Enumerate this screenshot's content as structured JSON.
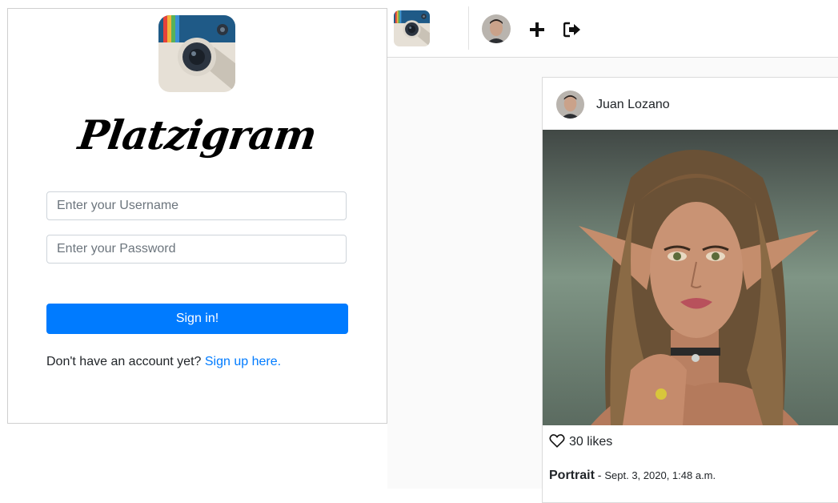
{
  "login": {
    "brand_title": "Platzigram",
    "username_placeholder": "Enter your Username",
    "password_placeholder": "Enter your Password",
    "signin_label": "Sign in!",
    "signup_prompt": "Don't have an account yet?",
    "signup_link": "Sign up here."
  },
  "navbar": {
    "icons": [
      "app-logo-icon",
      "avatar",
      "plus-icon",
      "logout-icon"
    ]
  },
  "post": {
    "author": "Juan Lozano",
    "likes": "30 likes",
    "title": "Portrait",
    "separator": " - ",
    "date": "Sept. 3, 2020, 1:48 a.m."
  },
  "colors": {
    "primary": "#007bff",
    "border": "#dbdbdb",
    "app_background": "#fafafa"
  }
}
